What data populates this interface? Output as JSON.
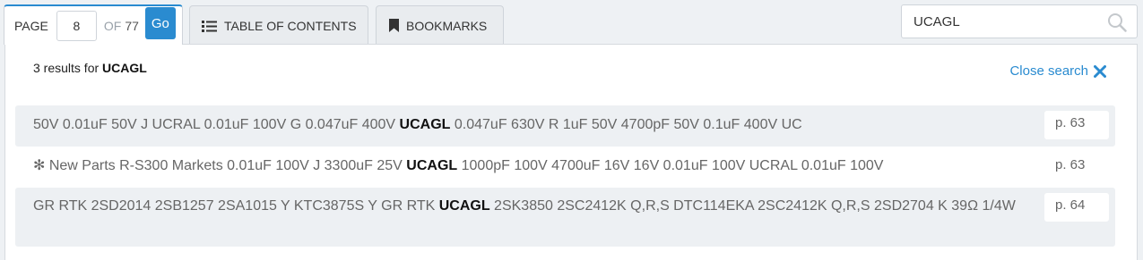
{
  "nav": {
    "page_label": "PAGE",
    "page_value": "8",
    "of_label": "OF",
    "total_pages": "77",
    "go_label": "Go",
    "toc_label": "TABLE OF CONTENTS",
    "bookmarks_label": "BOOKMARKS"
  },
  "search": {
    "query": "UCAGL"
  },
  "results_panel": {
    "count_prefix": "3 results for",
    "count_query": "UCAGL",
    "close_label": "Close search",
    "results": [
      {
        "before": "50V 0.01uF 50V J UCRAL 0.01uF 100V G 0.047uF 400V ",
        "match": "UCAGL",
        "after": " 0.047uF 630V R 1uF 50V 4700pF 50V 0.1uF 400V UC",
        "page": "p. 63"
      },
      {
        "before": "✻ New Parts R-S300 Markets 0.01uF 100V J 3300uF 25V ",
        "match": "UCAGL",
        "after": " 1000pF 100V 4700uF 16V 16V 0.01uF 100V UCRAL 0.01uF 100V",
        "page": "p. 63"
      },
      {
        "before": "GR RTK 2SD2014 2SB1257 2SA1015 Y KTC3875S Y GR RTK ",
        "match": "UCAGL",
        "after": " 2SK3850 2SC2412K Q,R,S DTC114EKA 2SC2412K Q,R,S 2SD2704 K 39Ω 1/4W",
        "page": "p. 64"
      }
    ]
  },
  "colors": {
    "accent": "#2a8bd0",
    "row_shade": "#edf0f3"
  }
}
